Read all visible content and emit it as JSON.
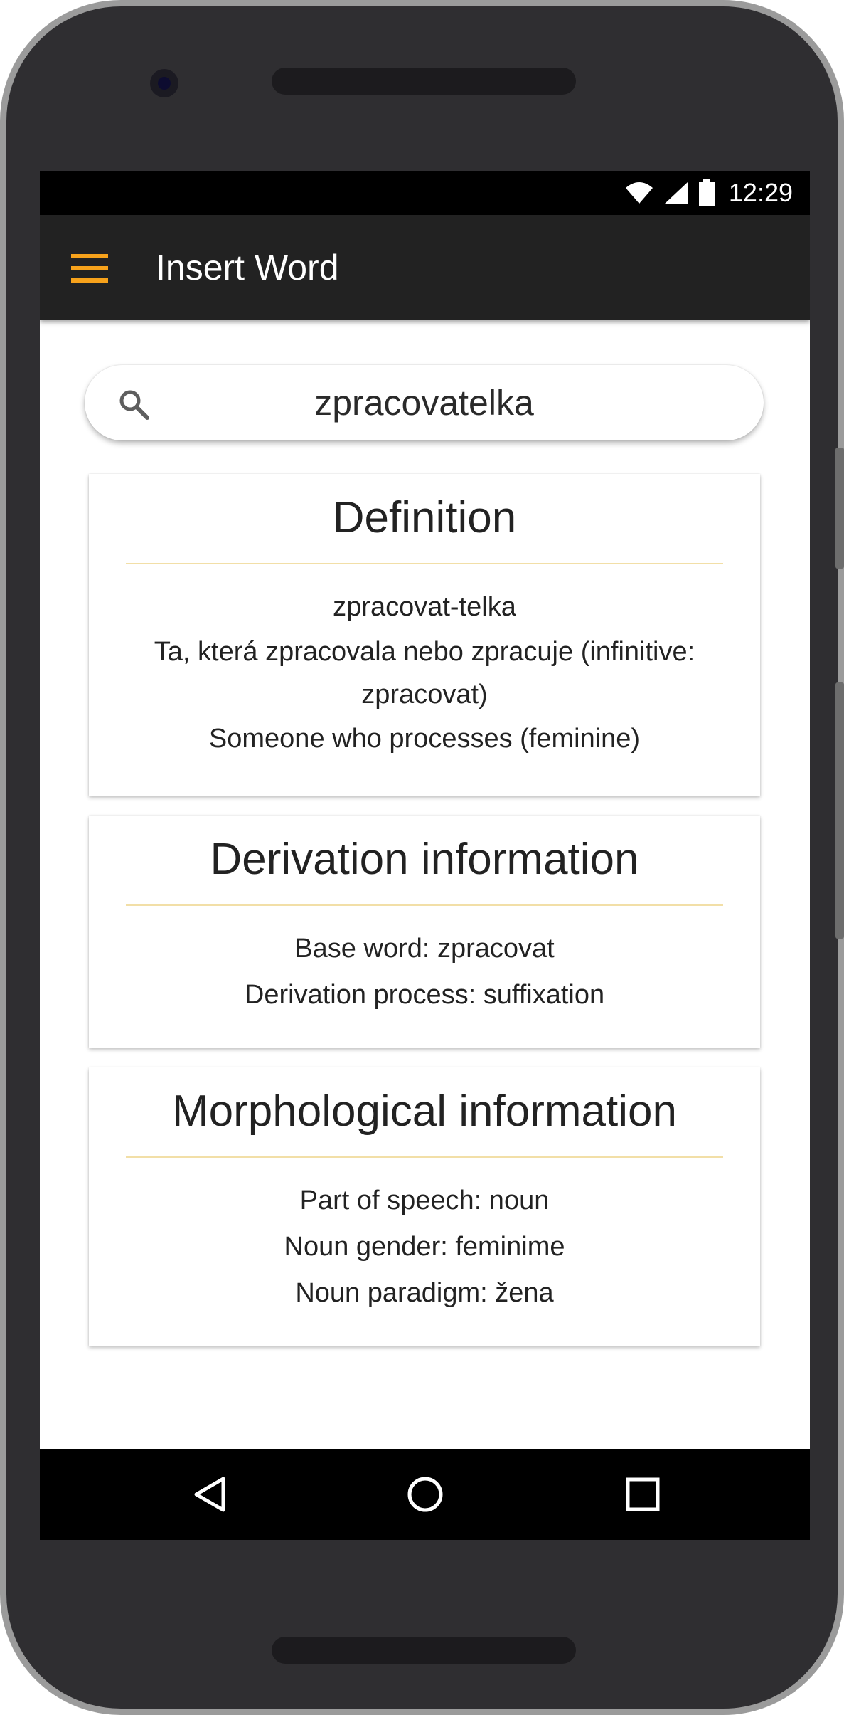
{
  "status_bar": {
    "time": "12:29",
    "icons": [
      "wifi-icon",
      "cellular-signal-icon",
      "battery-icon"
    ]
  },
  "app_bar": {
    "menu_icon": "hamburger-menu-icon",
    "title": "Insert Word"
  },
  "search": {
    "icon": "search-icon",
    "value": "zpracovatelka"
  },
  "cards": {
    "definition": {
      "title": "Definition",
      "lines": [
        "zpracovat-telka",
        "Ta, která zpracovala nebo zpracuje (infinitive: zpracovat)",
        "Someone who processes (feminine)"
      ]
    },
    "derivation": {
      "title": "Derivation information",
      "lines": [
        "Base word: zpracovat",
        "Derivation process: suffixation"
      ]
    },
    "morphology": {
      "title": "Morphological information",
      "lines": [
        "Part of speech: noun",
        "Noun gender: feminime",
        "Noun paradigm: žena"
      ]
    }
  },
  "nav_bar": {
    "buttons": [
      "back-icon",
      "home-icon",
      "recents-icon"
    ]
  },
  "colors": {
    "accent": "#f7a21b",
    "app_bar": "#222222",
    "divider": "#f2dfa7",
    "phone_body": "#2f2e31"
  }
}
